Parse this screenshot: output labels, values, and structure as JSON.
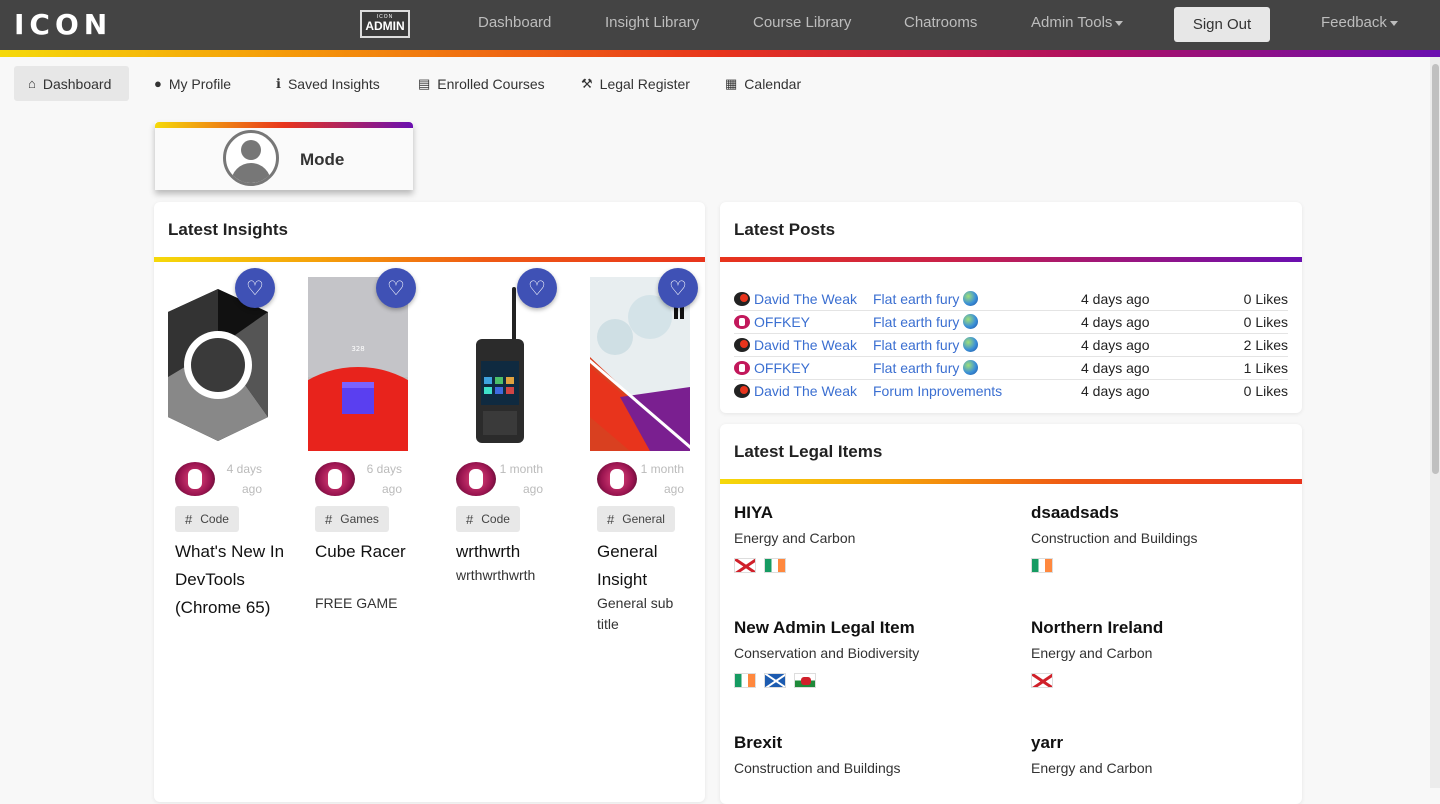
{
  "header": {
    "logo": "ICON",
    "admin_badge_small": "ICON",
    "admin_badge_big": "ADMIN",
    "nav": [
      "Dashboard",
      "Insight Library",
      "Course Library",
      "Chatrooms",
      "Admin Tools"
    ],
    "sign_out": "Sign Out",
    "feedback": "Feedback"
  },
  "subnav": {
    "items": [
      {
        "label": "Dashboard",
        "icon": "home-icon",
        "active": true
      },
      {
        "label": "My Profile",
        "icon": "user-icon"
      },
      {
        "label": "Saved Insights",
        "icon": "info-icon"
      },
      {
        "label": "Enrolled Courses",
        "icon": "bank-icon"
      },
      {
        "label": "Legal Register",
        "icon": "gavel-icon"
      },
      {
        "label": "Calendar",
        "icon": "calendar-icon"
      }
    ]
  },
  "profile": {
    "name": "Mode"
  },
  "latest_insights": {
    "title": "Latest Insights",
    "items": [
      {
        "ago_1": "4 days",
        "ago_2": "ago",
        "tag": "Code",
        "title": "What's New In DevTools (Chrome 65)",
        "subtitle": ""
      },
      {
        "ago_1": "6 days",
        "ago_2": "ago",
        "tag": "Games",
        "title": "Cube Racer",
        "subtitle": "FREE GAME",
        "thumb_text": "328"
      },
      {
        "ago_1": "1 month",
        "ago_2": "ago",
        "tag": "Code",
        "title": "wrthwrth",
        "subtitle": "wrthwrthwrth"
      },
      {
        "ago_1": "1 month",
        "ago_2": "ago",
        "tag": "General",
        "title": "General Insight",
        "subtitle": "General sub title"
      }
    ]
  },
  "latest_posts": {
    "title": "Latest Posts",
    "rows": [
      {
        "author": "David The Weak",
        "topic": "Flat earth fury",
        "time": "4 days ago",
        "likes": "0 Likes",
        "avatar": "dark",
        "globe": true
      },
      {
        "author": "OFFKEY",
        "topic": "Flat earth fury",
        "time": "4 days ago",
        "likes": "0 Likes",
        "avatar": "off",
        "globe": true
      },
      {
        "author": "David The Weak",
        "topic": "Flat earth fury",
        "time": "4 days ago",
        "likes": "2 Likes",
        "avatar": "dark",
        "globe": true
      },
      {
        "author": "OFFKEY",
        "topic": "Flat earth fury",
        "time": "4 days ago",
        "likes": "1 Likes",
        "avatar": "off",
        "globe": true
      },
      {
        "author": "David The Weak",
        "topic": "Forum Inprovements",
        "time": "4 days ago",
        "likes": "0 Likes",
        "avatar": "dark",
        "globe": false
      }
    ]
  },
  "latest_legal": {
    "title": "Latest Legal Items",
    "items": [
      {
        "title": "HIYA",
        "category": "Energy and Carbon",
        "flags": [
          "northern-ireland-flag-icon",
          "ireland-flag-icon"
        ]
      },
      {
        "title": "dsaadsads",
        "category": "Construction and Buildings",
        "flags": [
          "ireland-flag-icon"
        ]
      },
      {
        "title": "New Admin Legal Item",
        "category": "Conservation and Biodiversity",
        "flags": [
          "ireland-flag-icon",
          "scotland-flag-icon",
          "wales-flag-icon"
        ]
      },
      {
        "title": "Northern Ireland",
        "category": "Energy and Carbon",
        "flags": [
          "northern-ireland-flag-icon"
        ]
      },
      {
        "title": "Brexit",
        "category": "Construction and Buildings",
        "flags": []
      },
      {
        "title": "yarr",
        "category": "Energy and Carbon",
        "flags": []
      }
    ]
  },
  "colors": {
    "header_bg": "#444444",
    "accent_blue": "#3f51b5",
    "link_blue": "#3b6fd1",
    "gradient": [
      "#f5d90a",
      "#e8341c",
      "#6a0fb0"
    ]
  }
}
